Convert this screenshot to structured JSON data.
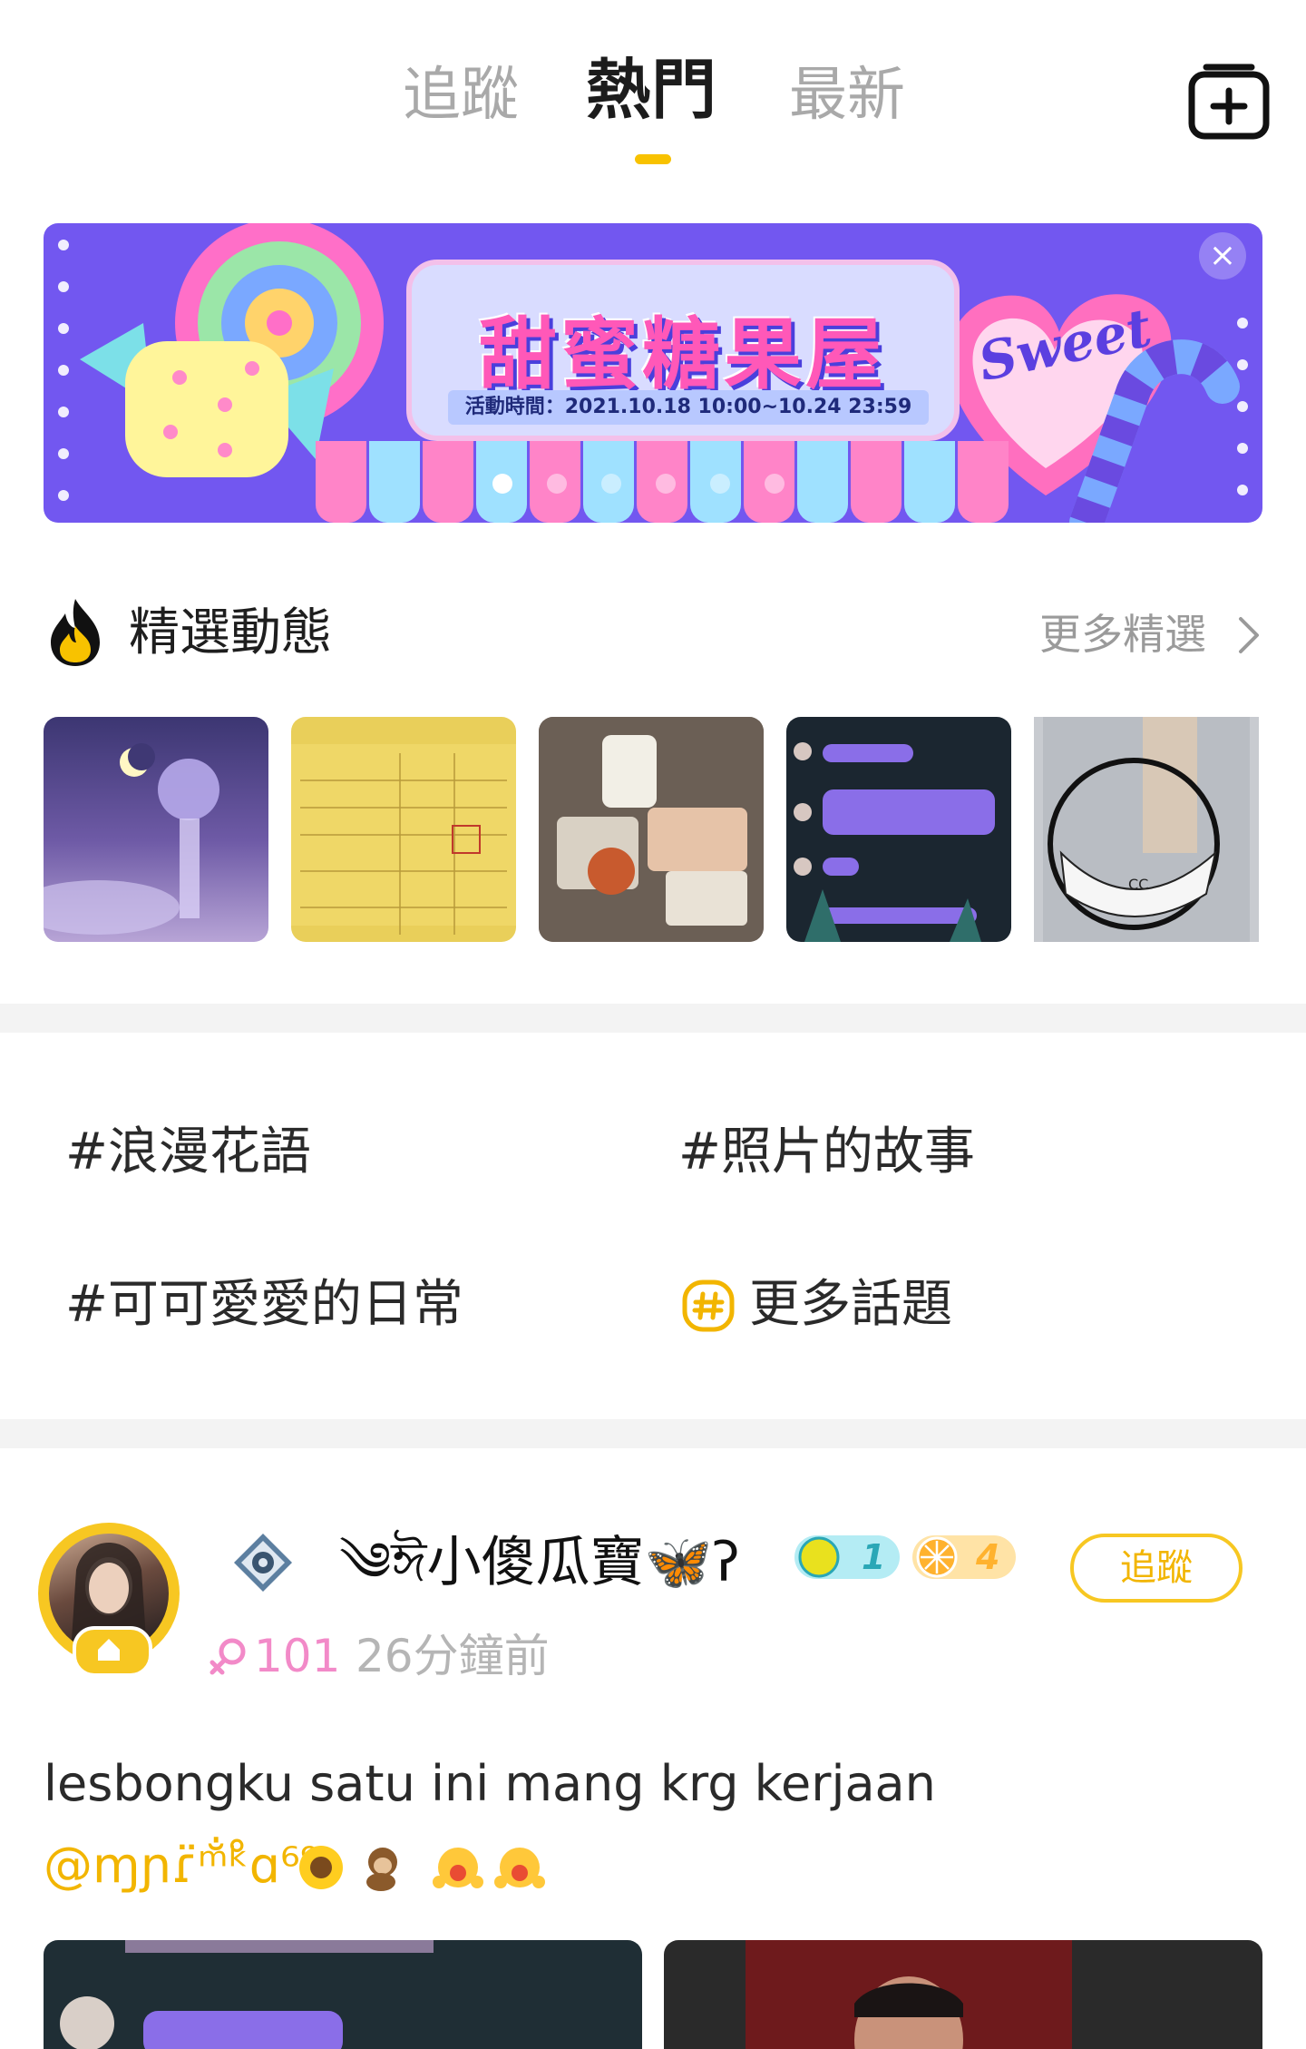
{
  "tabs": [
    {
      "label": "追蹤",
      "active": false
    },
    {
      "label": "熱門",
      "active": true
    },
    {
      "label": "最新",
      "active": false
    }
  ],
  "accent_color": "#f8c200",
  "banner": {
    "title": "甜蜜糖果屋",
    "date_text": "活動時間：2021.10.18 10:00~10.24 23:59",
    "heart_text": "Sweet",
    "close_symbol": "×",
    "page_count": 6,
    "current_page": 1
  },
  "featured": {
    "title": "精選動態",
    "more_label": "更多精選",
    "thumbnails": [
      {
        "name": "night-sky-wind-chime"
      },
      {
        "name": "covid-vaccination-record"
      },
      {
        "name": "snack-food-haul"
      },
      {
        "name": "chat-screenshot"
      },
      {
        "name": "white-handbag-fashion"
      }
    ]
  },
  "topics": [
    {
      "label": "#浪漫花語"
    },
    {
      "label": "#照片的故事"
    },
    {
      "label": "#可可愛愛的日常"
    },
    {
      "label": "更多話題"
    }
  ],
  "post": {
    "username": "༄ঈ小傻瓜寶🦋ʔ",
    "level_badge_1": "1",
    "level_badge_2": "4",
    "follow_label": "追蹤",
    "gender_count": "101",
    "time_ago": "26分鐘前",
    "text": "lesbongku satu ini mang krg kerjaan",
    "mention": "@ɱɲɾ̈ᵐ̐ᵏ̊ɑ⁶⁹",
    "emojis": [
      "sunflower",
      "monkey",
      "scream-face",
      "scream-face"
    ]
  }
}
